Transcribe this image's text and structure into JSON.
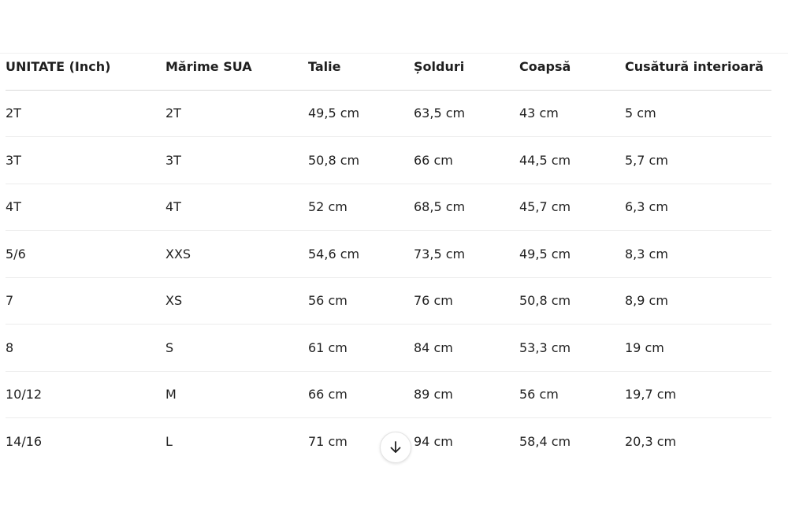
{
  "table": {
    "headers": [
      "UNITATE (Inch)",
      "Mărime SUA",
      "Talie",
      "Șolduri",
      "Coapsă",
      "Cusătură interioară"
    ],
    "rows": [
      [
        "2T",
        "2T",
        "49,5 cm",
        "63,5 cm",
        "43 cm",
        "5 cm"
      ],
      [
        "3T",
        "3T",
        "50,8 cm",
        "66 cm",
        "44,5 cm",
        "5,7 cm"
      ],
      [
        "4T",
        "4T",
        "52 cm",
        "68,5 cm",
        "45,7 cm",
        "6,3 cm"
      ],
      [
        "5/6",
        "XXS",
        "54,6 cm",
        "73,5 cm",
        "49,5 cm",
        "8,3 cm"
      ],
      [
        "7",
        "XS",
        "56 cm",
        "76 cm",
        "50,8 cm",
        "8,9 cm"
      ],
      [
        "8",
        "S",
        "61 cm",
        "84 cm",
        "53,3 cm",
        "19 cm"
      ],
      [
        "10/12",
        "M",
        "66 cm",
        "89 cm",
        "56 cm",
        "19,7 cm"
      ],
      [
        "14/16",
        "L",
        "71 cm",
        "94 cm",
        "58,4 cm",
        "20,3 cm"
      ]
    ]
  },
  "scroll_button": {
    "icon": "arrow-down-icon"
  },
  "colors": {
    "text": "#1f1f1f",
    "divider": "#ececec"
  }
}
